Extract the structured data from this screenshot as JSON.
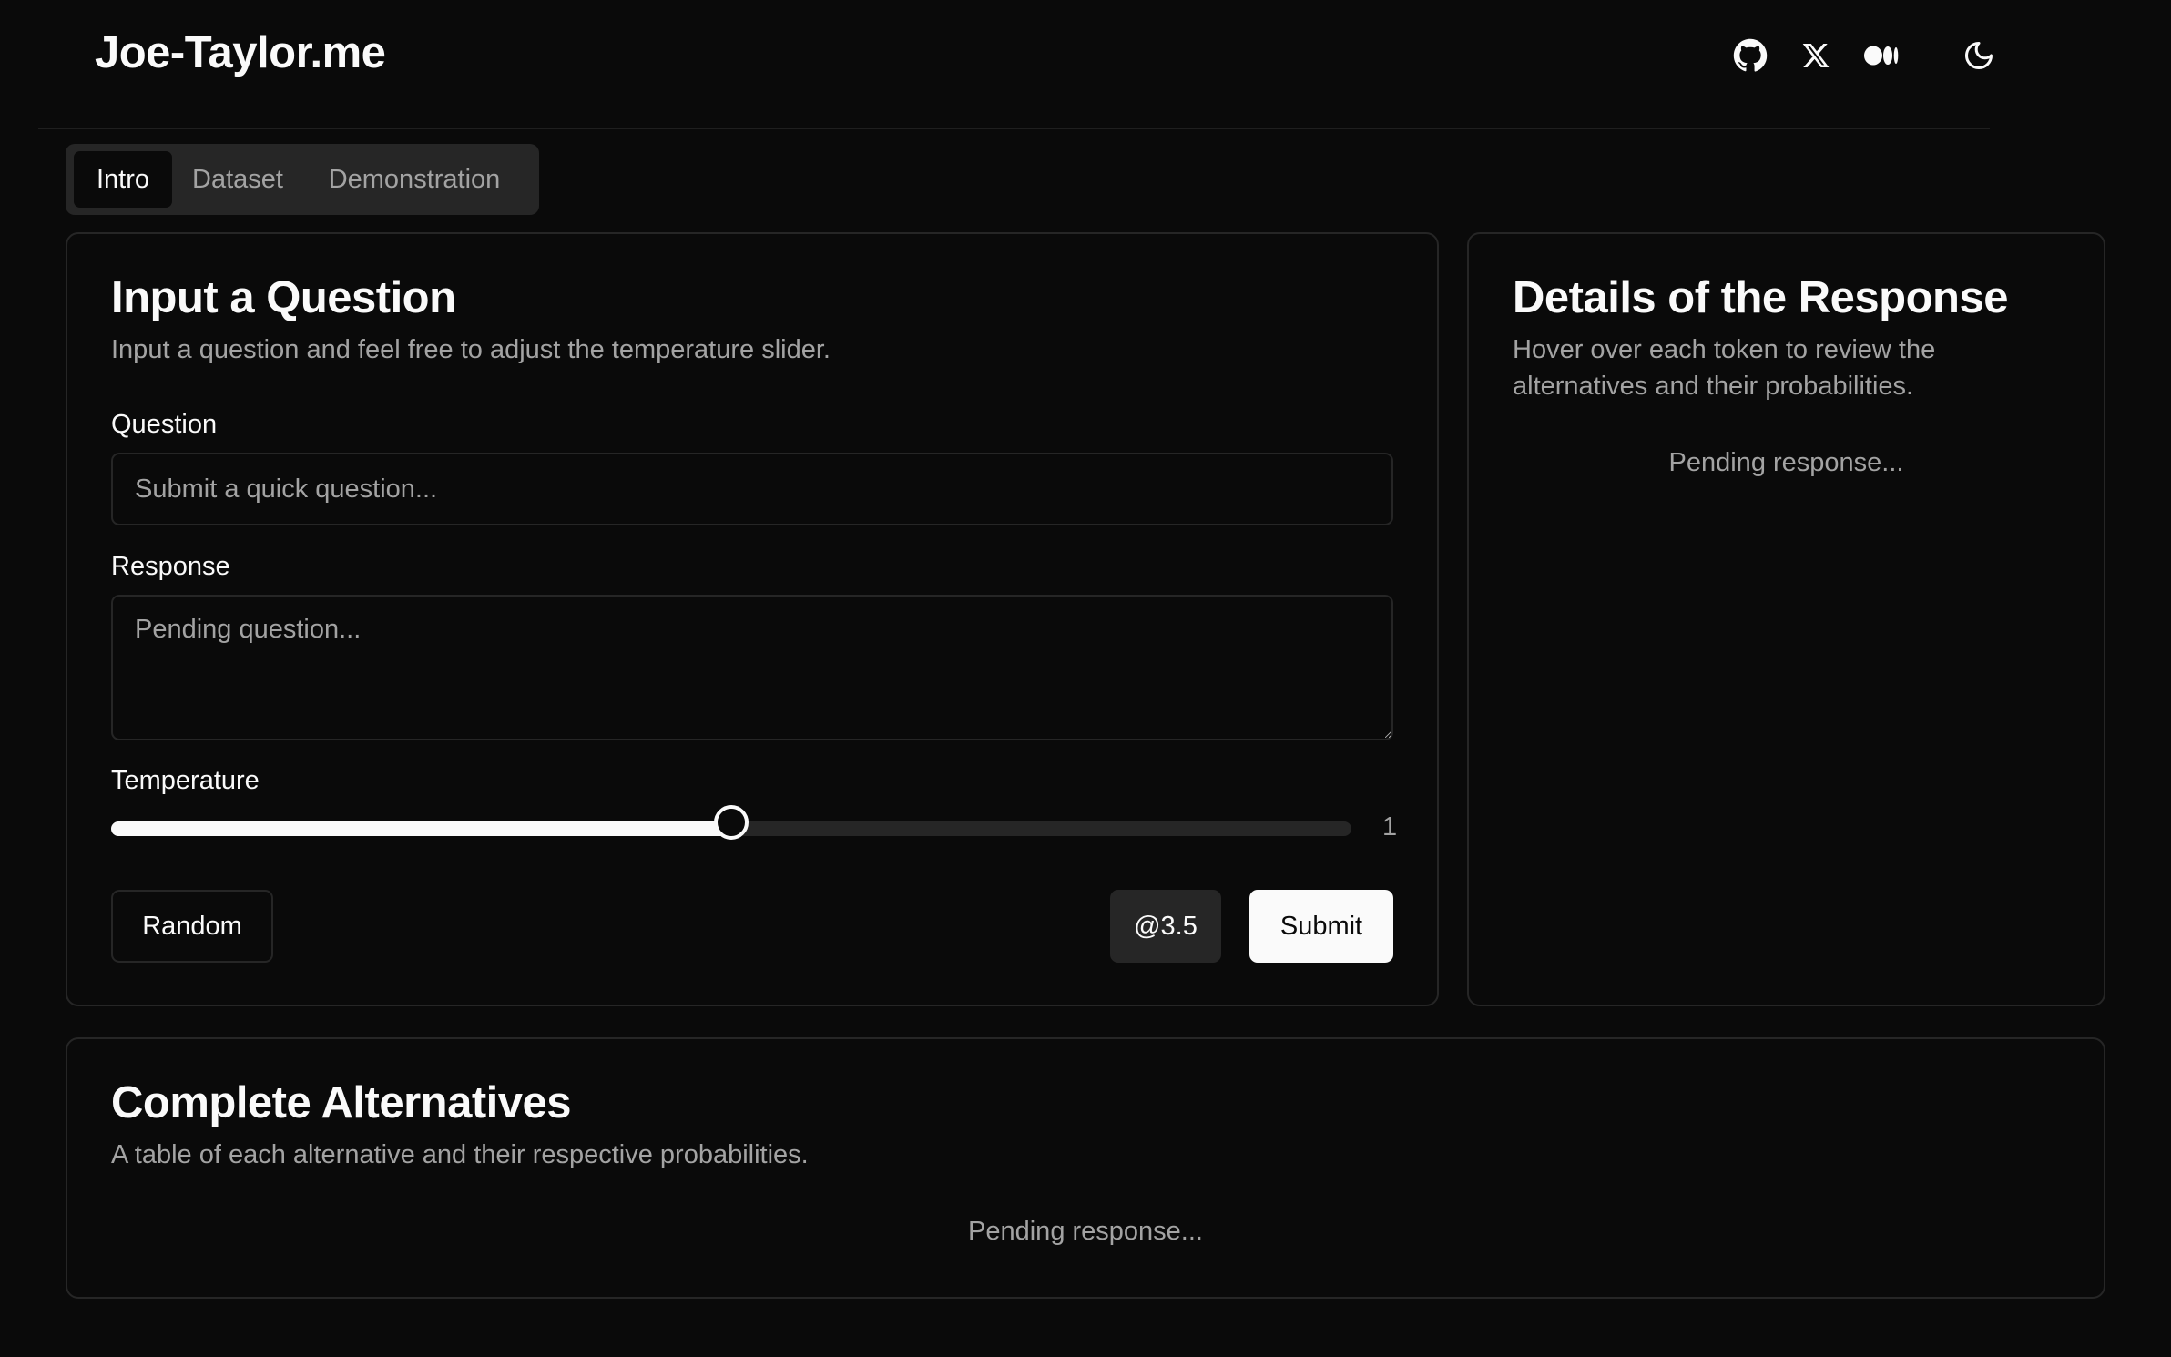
{
  "header": {
    "brand": "Joe-Taylor.me",
    "icons": [
      "github-icon",
      "x-icon",
      "medium-icon",
      "moon-icon"
    ]
  },
  "tabs": [
    {
      "label": "Intro",
      "active": true
    },
    {
      "label": "Dataset",
      "active": false
    },
    {
      "label": "Demonstration",
      "active": false
    }
  ],
  "input_card": {
    "title": "Input a Question",
    "description": "Input a question and feel free to adjust the temperature slider.",
    "question_label": "Question",
    "question_placeholder": "Submit a quick question...",
    "response_label": "Response",
    "response_placeholder": "Pending question...",
    "temperature_label": "Temperature",
    "temperature_value": "1",
    "temperature_fraction": 0.5,
    "random_button": "Random",
    "model_button": "@3.5",
    "submit_button": "Submit"
  },
  "details_card": {
    "title": "Details of the Response",
    "description": "Hover over each token to review the alternatives and their probabilities.",
    "pending": "Pending response..."
  },
  "alternatives_card": {
    "title": "Complete Alternatives",
    "description": "A table of each alternative and their respective probabilities.",
    "pending": "Pending response..."
  },
  "colors": {
    "background": "#0a0a0a",
    "border": "#262626",
    "foreground": "#fafafa",
    "muted": "#a3a3a3"
  }
}
